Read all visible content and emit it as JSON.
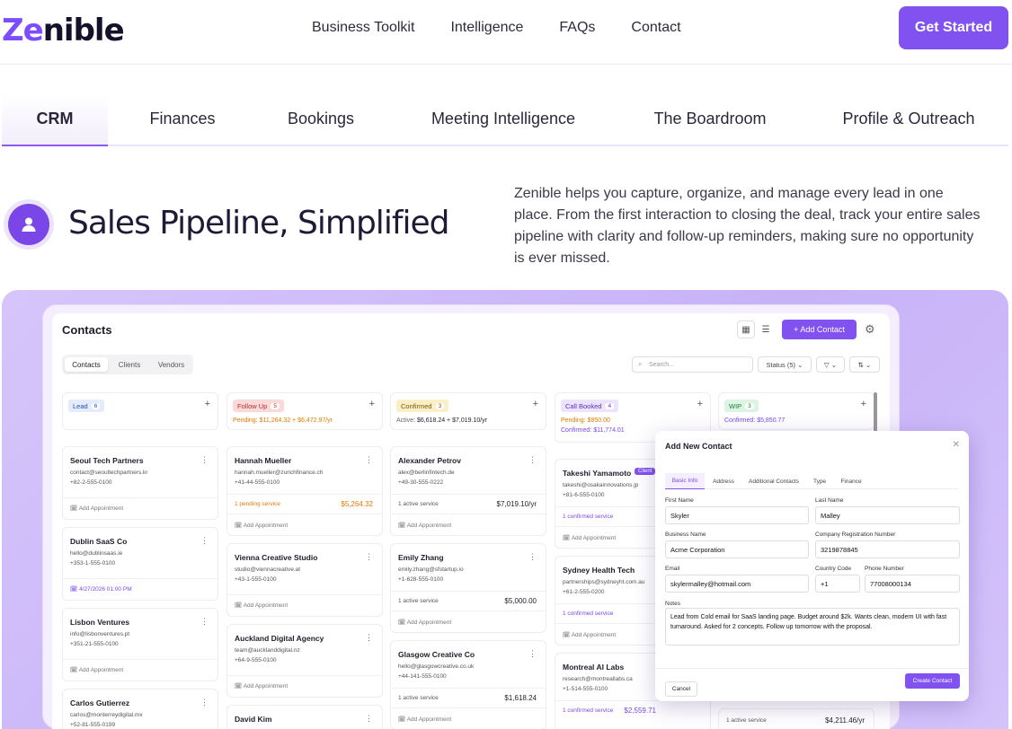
{
  "nav": {
    "logo_a": "Ze",
    "logo_b": "nible",
    "links": [
      "Business Toolkit",
      "Intelligence",
      "FAQs",
      "Contact"
    ],
    "cta": "Get Started"
  },
  "tabs": [
    "CRM",
    "Finances",
    "Bookings",
    "Meeting Intelligence",
    "The Boardroom",
    "Profile & Outreach"
  ],
  "hero": {
    "title": "Sales Pipeline, Simplified",
    "desc": "Zenible helps you capture, organize, and manage every lead in one place. From the first interaction to closing the deal, track your entire sales pipeline with clarity and follow-up reminders, making sure no opportunity is ever missed."
  },
  "app": {
    "title": "Contacts",
    "add": "+ Add Contact",
    "segments": [
      "Contacts",
      "Clients",
      "Vendors"
    ],
    "search_placeholder": "Search...",
    "status": "Status (5)",
    "columns": [
      {
        "label": "Lead",
        "count": "6",
        "chip_bg": "#e4ecfb",
        "chip_fg": "#2d4fb0"
      },
      {
        "label": "Follow Up",
        "count": "5",
        "chip_bg": "#fbd9d9",
        "chip_fg": "#b13030",
        "sum_a": "Pending:",
        "sum_b": "$11,264.32 + $6,472.97/yr",
        "sum_color": "#e07b00"
      },
      {
        "label": "Confirmed",
        "count": "3",
        "chip_bg": "#fbefc7",
        "chip_fg": "#7a5a00",
        "sum_a": "Active:",
        "sum_b": "$6,618.24 + $7,019.10/yr",
        "sum_color": "#222"
      },
      {
        "label": "Call Booked",
        "count": "4",
        "chip_bg": "#ece3fd",
        "chip_fg": "#5a2fc0",
        "sum_a": "Pending:",
        "sum_b": "$950.00",
        "sum2_a": "Confirmed:",
        "sum2_b": "$11,774.01",
        "sum_color": "#e07b00"
      },
      {
        "label": "WIP",
        "count": "3",
        "chip_bg": "#dcf5e3",
        "chip_fg": "#1f7a3d",
        "sum_a": "Confirmed:",
        "sum_b": "$5,850.77",
        "sum_color": "#7b46e8"
      }
    ],
    "cards": {
      "lead": [
        {
          "name": "Seoul Tech Partners",
          "email": "contact@seoultechpartners.kr",
          "phone": "+82-2-555-0100",
          "appt": "Add Appointment"
        },
        {
          "name": "Dublin SaaS Co",
          "email": "hello@dublinsaas.ie",
          "phone": "+353-1-555-0100",
          "appt": "4/27/2026 01:00 PM"
        },
        {
          "name": "Lisbon Ventures",
          "email": "info@lisbonventures.pt",
          "phone": "+351-21-555-0100",
          "appt": "Add Appointment"
        },
        {
          "name": "Carlos Gutierrez",
          "email": "carlos@monterreydigital.mx",
          "phone": "+52-81-555-0199"
        }
      ],
      "follow": [
        {
          "name": "Hannah Mueller",
          "email": "hannah.mueller@zurichfinance.ch",
          "phone": "+41-44-555-0100",
          "svc": "1 pending service",
          "val": "$5,264.32",
          "appt": "Add Appointment"
        },
        {
          "name": "Vienna Creative Studio",
          "email": "studio@viennacreative.at",
          "phone": "+43-1-555-0100",
          "appt": "Add Appointment"
        },
        {
          "name": "Auckland Digital Agency",
          "email": "team@aucklanddigital.nz",
          "phone": "+64-9-555-0100",
          "appt": "Add Appointment"
        },
        {
          "name": "David Kim"
        }
      ],
      "confirmed": [
        {
          "name": "Alexander Petrov",
          "email": "alex@berlinfintech.de",
          "phone": "+49-30-555-0222",
          "svc": "1 active service",
          "val": "$7,019.10/yr",
          "appt": "Add Appointment"
        },
        {
          "name": "Emily Zhang",
          "email": "emily.zhang@sfstartup.io",
          "phone": "+1-628-555-0100",
          "svc": "1 active service",
          "val": "$5,000.00",
          "appt": "Add Appointment"
        },
        {
          "name": "Glasgow Creative Co",
          "email": "hello@glasgowcreative.co.uk",
          "phone": "+44-141-555-0100",
          "svc": "1 active service",
          "val": "$1,618.24",
          "appt": "Add Appointment"
        }
      ],
      "call": [
        {
          "name": "Takeshi Yamamoto",
          "badge": "Client",
          "email": "takeshi@osakainnovations.jp",
          "phone": "+81-6-555-0100",
          "svc": "1 confirmed service",
          "appt": "Add Appointment"
        },
        {
          "name": "Sydney Health Tech",
          "email": "partnerships@sydneyht.com.au",
          "phone": "+61-2-555-0200",
          "svc": "1 confirmed service",
          "appt": "Add Appointment"
        },
        {
          "name": "Montreal AI Labs",
          "email": "research@montreallabs.ca",
          "phone": "+1-514-555-0100",
          "svc": "1 confirmed service",
          "val": "$2,559.71"
        }
      ],
      "wip_bottom": {
        "svc": "1 active service",
        "val": "$4,211.46/yr"
      }
    },
    "modal": {
      "title": "Add New Contact",
      "tabs": [
        "Basic Info",
        "Address",
        "Additional Contacts",
        "Type",
        "Finance"
      ],
      "first_label": "First Name",
      "first": "Skyler",
      "last_label": "Last Name",
      "last": "Malley",
      "biz_label": "Business Name",
      "biz": "Acme Corporation",
      "reg_label": "Company Registration Number",
      "reg": "3219878845",
      "email_label": "Email",
      "email": "skylermalley@hotmail.com",
      "cc_label": "Country Code",
      "cc": "+1",
      "phone_label": "Phone Number",
      "phone": "77008000134",
      "notes_label": "Notes",
      "notes": "Lead from Cold email for SaaS landing page. Budget around $2k. Wants clean, modern UI with fast turnaround. Asked for 2 concepts. Follow up tomorrow with the proposal.",
      "cancel": "Cancel",
      "create": "Create Contact"
    }
  }
}
